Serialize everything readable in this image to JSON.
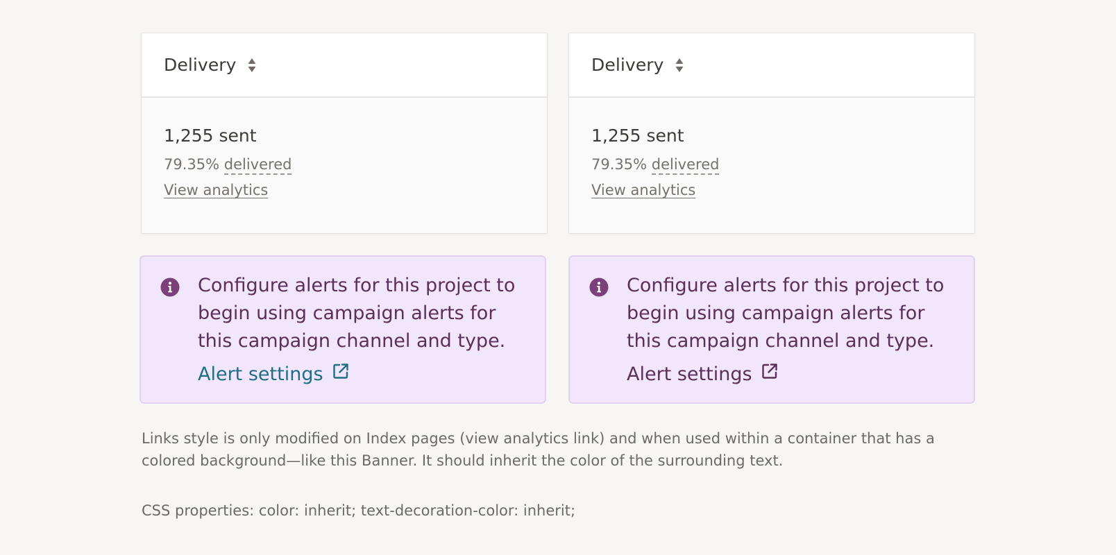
{
  "cards": [
    {
      "title": "Delivery",
      "sent": "1,255 sent",
      "rate_value": "79.35%",
      "rate_label": "delivered",
      "link": "View analytics"
    },
    {
      "title": "Delivery",
      "sent": "1,255 sent",
      "rate_value": "79.35%",
      "rate_label": "delivered",
      "link": "View analytics"
    }
  ],
  "banners": [
    {
      "message": "Configure alerts for this project to begin using campaign alerts for this campaign channel and type.",
      "link": "Alert settings",
      "link_color": "#1f6e84"
    },
    {
      "message": "Configure alerts for this project to begin using campaign alerts for this campaign channel and type.",
      "link": "Alert settings",
      "link_color": "#5b2f59"
    }
  ],
  "notes": {
    "description": "Links style is only modified on Index pages (view analytics link) and when used within a container that has a colored background—like this Banner. It should inherit the color of the surrounding text.",
    "css": "CSS properties: color: inherit; text-decoration-color: inherit;"
  },
  "colors": {
    "background": "#f7f6f4",
    "banner_bg": "#f1e6fb",
    "banner_text": "#5b2f59",
    "default_link": "#1f6e84"
  },
  "icons": [
    "sort-icon",
    "info-icon",
    "external-link-icon"
  ]
}
